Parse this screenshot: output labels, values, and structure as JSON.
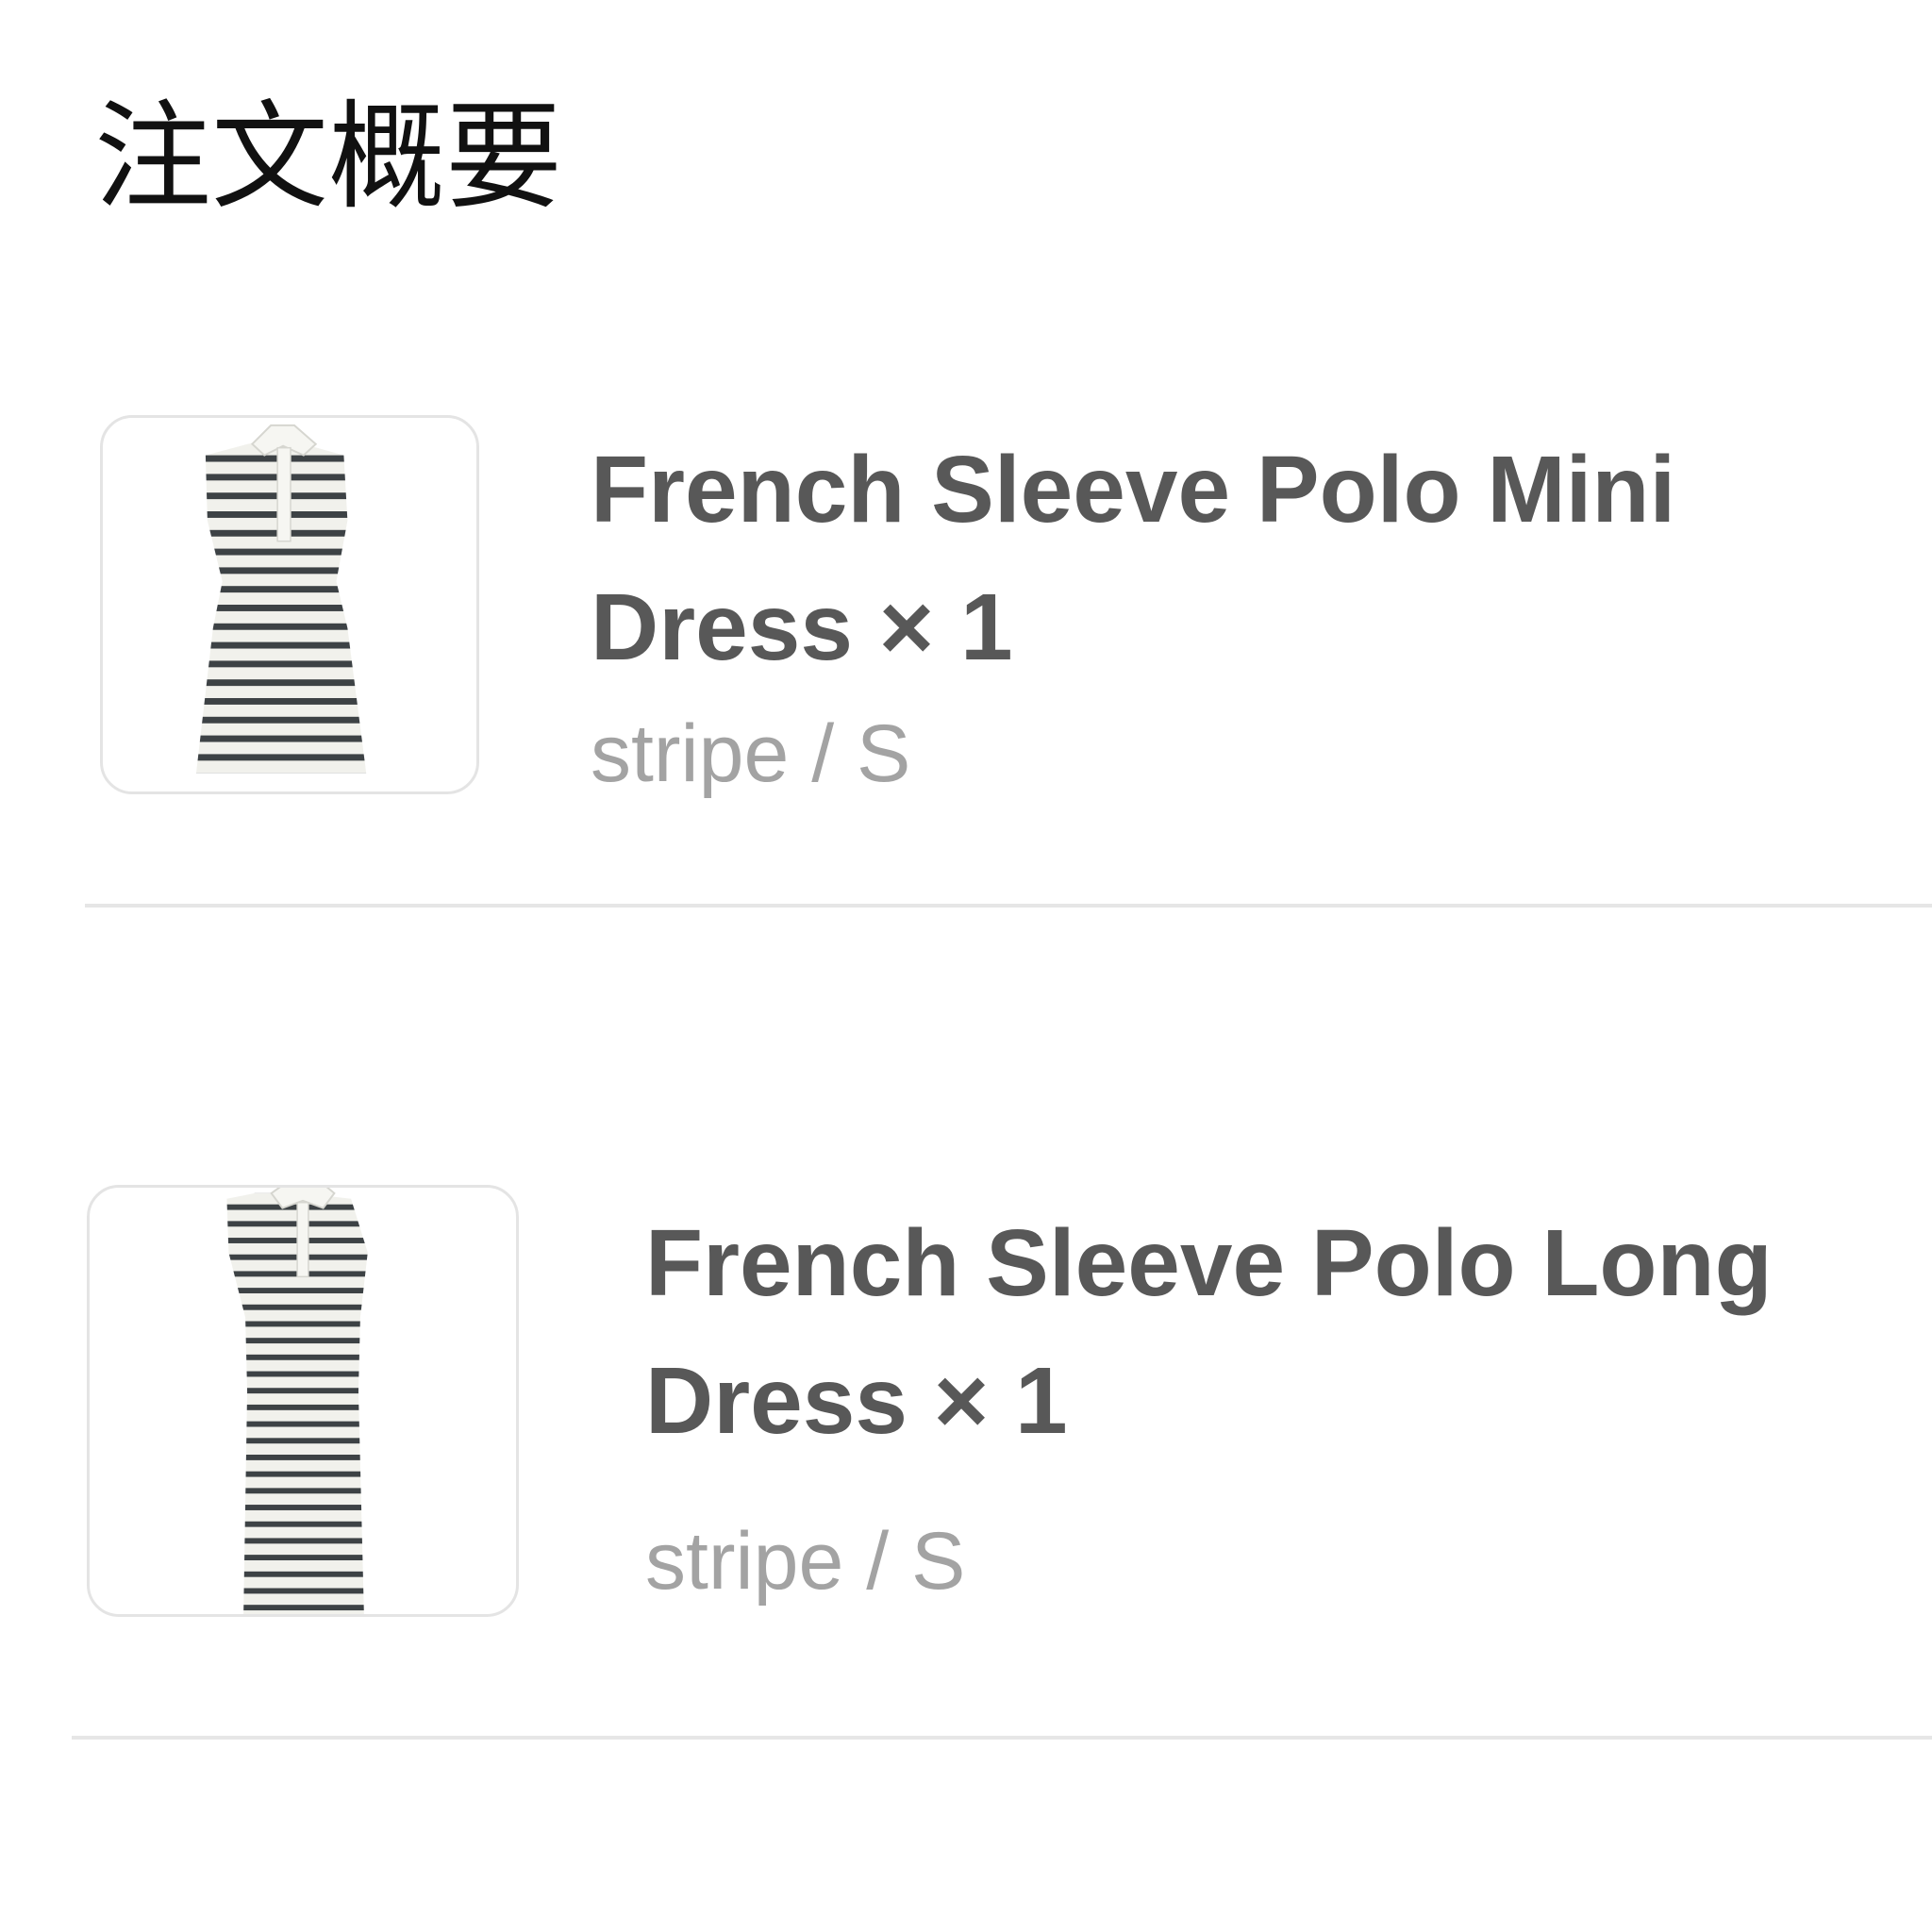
{
  "order_summary": {
    "title": "注文概要",
    "items": [
      {
        "name": "French Sleeve Polo Mini Dress",
        "quantity_text": "× 1",
        "variant": "stripe / S",
        "thumbnail": "striped-mini-dress-image"
      },
      {
        "name": "French Sleeve Polo Long Dress",
        "quantity_text": "× 1",
        "variant": "stripe / S",
        "thumbnail": "striped-long-dress-image"
      }
    ]
  },
  "colors": {
    "title": "#111111",
    "item_name": "#585858",
    "variant": "#a3a3a3",
    "divider": "#e6e6e6",
    "thumb_border": "#e4e4e4"
  }
}
